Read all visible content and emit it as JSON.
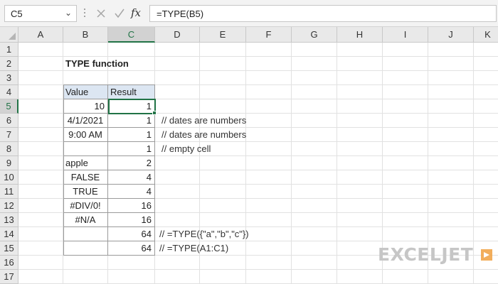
{
  "formula_bar": {
    "name_box": "C5",
    "formula": "=TYPE(B5)",
    "icons": [
      "cancel-icon",
      "enter-icon",
      "insert-function-icon"
    ],
    "fx_label": "fx"
  },
  "columns": [
    "A",
    "B",
    "C",
    "D",
    "E",
    "F",
    "G",
    "H",
    "I",
    "J",
    "K"
  ],
  "rows": [
    "1",
    "2",
    "3",
    "4",
    "5",
    "6",
    "7",
    "8",
    "9",
    "10",
    "11",
    "12",
    "13",
    "14",
    "15",
    "16",
    "17"
  ],
  "selected_column": "C",
  "selected_row": "5",
  "title": "TYPE function",
  "table": {
    "headers": [
      "Value",
      "Result"
    ],
    "rows": [
      {
        "value": "10",
        "result": "1",
        "note": ""
      },
      {
        "value": "4/1/2021",
        "result": "1",
        "note": "// dates are numbers"
      },
      {
        "value": "9:00 AM",
        "result": "1",
        "note": "// dates are numbers"
      },
      {
        "value": "",
        "result": "1",
        "note": "// empty cell"
      },
      {
        "value": "apple",
        "result": "2",
        "note": ""
      },
      {
        "value": "FALSE",
        "result": "4",
        "note": ""
      },
      {
        "value": "TRUE",
        "result": "4",
        "note": ""
      },
      {
        "value": "#DIV/0!",
        "result": "16",
        "note": ""
      },
      {
        "value": "#N/A",
        "result": "16",
        "note": ""
      },
      {
        "value": "",
        "result": "64",
        "note": "// =TYPE({\"a\",\"b\",\"c\"})"
      },
      {
        "value": "",
        "result": "64",
        "note": "// =TYPE(A1:C1)"
      }
    ]
  },
  "colors": {
    "accent": "#217346",
    "header_fill": "#dce6f2",
    "logo": "#c6c6c6",
    "logo_mark": "#f0a040"
  },
  "logo": {
    "text": "EXCELJET"
  }
}
